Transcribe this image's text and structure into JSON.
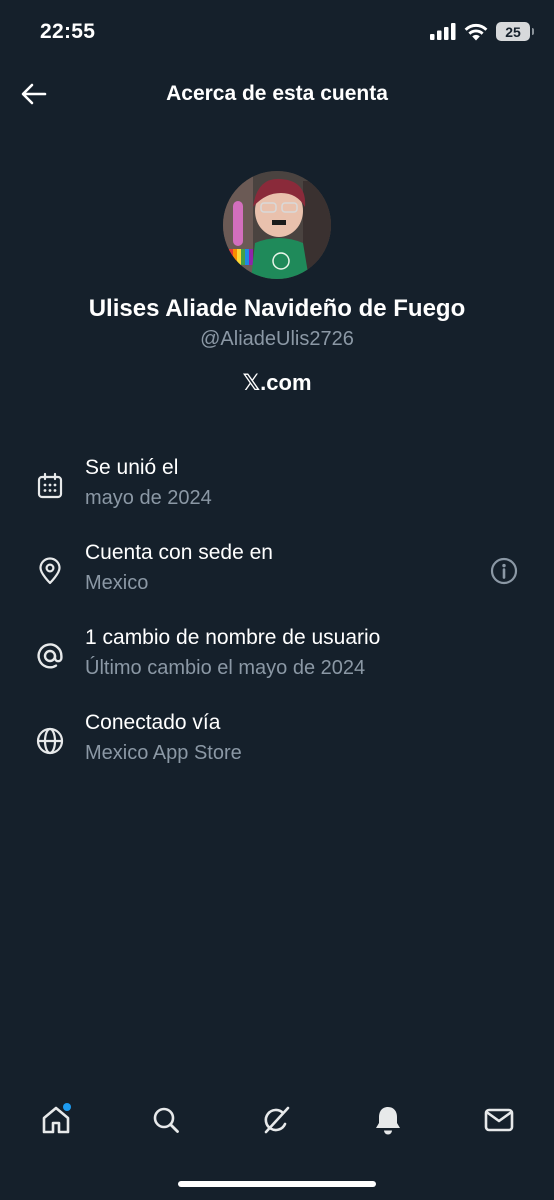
{
  "status_bar": {
    "time": "22:55",
    "battery": "25",
    "icons": [
      "signal-icon",
      "wifi-icon",
      "battery-icon"
    ]
  },
  "header": {
    "title": "Acerca de esta cuenta",
    "back_icon": "back-arrow-icon"
  },
  "profile": {
    "name": "Ulises Aliade Navideño de Fuego",
    "handle": "@AliadeUlis2726",
    "domain": "𝕏.com"
  },
  "info": [
    {
      "icon": "calendar-icon",
      "title": "Se unió el",
      "subtitle": "mayo de 2024"
    },
    {
      "icon": "location-pin-icon",
      "title": "Cuenta con sede en",
      "subtitle": "Mexico",
      "action_icon": "info-circle-icon"
    },
    {
      "icon": "at-sign-icon",
      "title": "1 cambio de nombre de usuario",
      "subtitle": "Último cambio el mayo de 2024"
    },
    {
      "icon": "globe-icon",
      "title": "Conectado vía",
      "subtitle": "Mexico App Store"
    }
  ],
  "bottom_nav": {
    "items": [
      "home-icon",
      "search-icon",
      "grok-icon",
      "notifications-bell-icon",
      "messages-envelope-icon"
    ],
    "home_has_badge": true
  },
  "colors": {
    "background": "#15202B",
    "primary_text": "#FFFFFF",
    "secondary_text": "#8B98A5",
    "accent": "#1D9BF0"
  }
}
